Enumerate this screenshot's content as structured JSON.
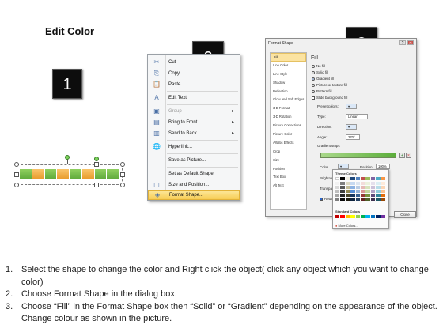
{
  "title": "Edit Color",
  "badges": [
    "1",
    "2",
    "3"
  ],
  "context_menu": {
    "items": [
      {
        "label": "Cut",
        "icon": "scissors-icon",
        "glyph": "✂"
      },
      {
        "label": "Copy",
        "icon": "copy-icon",
        "glyph": "⎘"
      },
      {
        "label": "Paste",
        "icon": "paste-icon",
        "glyph": "📋"
      },
      {
        "label": "Edit Text",
        "icon": "edit-text-icon",
        "glyph": "A"
      },
      {
        "label": "Group",
        "icon": "group-icon",
        "glyph": "▣"
      },
      {
        "label": "Bring to Front",
        "icon": "bring-front-icon",
        "glyph": "▤"
      },
      {
        "label": "Send to Back",
        "icon": "send-back-icon",
        "glyph": "▥"
      },
      {
        "label": "Hyperlink...",
        "icon": "hyperlink-icon",
        "glyph": "🌐"
      },
      {
        "label": "Save as Picture...",
        "icon": "",
        "glyph": ""
      },
      {
        "label": "Set as Default Shape",
        "icon": "",
        "glyph": ""
      },
      {
        "label": "Size and Position...",
        "icon": "size-position-icon",
        "glyph": "▢"
      },
      {
        "label": "Format Shape...",
        "icon": "format-shape-icon",
        "glyph": "◈"
      }
    ]
  },
  "dialog": {
    "title": "Format Shape",
    "nav": [
      "Fill",
      "Line Color",
      "Line Style",
      "Shadow",
      "Reflection",
      "Glow and Soft Edges",
      "3-D Format",
      "3-D Rotation",
      "Picture Corrections",
      "Picture Color",
      "Artistic Effects",
      "Crop",
      "Size",
      "Position",
      "Text Box",
      "Alt Text"
    ],
    "pane_title": "Fill",
    "fill_options": [
      "No fill",
      "Solid fill",
      "Gradient fill",
      "Picture or texture fill",
      "Pattern fill",
      "Slide background fill"
    ],
    "preset_colors_label": "Preset colors:",
    "type_label": "Type:",
    "type_value": "Linear",
    "direction_label": "Direction:",
    "angle_label": "Angle:",
    "angle_value": "270°",
    "gradient_stops_label": "Gradient stops",
    "color_label": "Color",
    "position_label": "Position:",
    "position_value": "100%",
    "brightness_label": "Brightness",
    "transparency_label": "Transparen",
    "rotate_label": "Rotate",
    "theme_colors_label": "Theme Colors",
    "standard_colors_label": "Standard Colors",
    "more_colors_label": "More Colors...",
    "close_label": "Close",
    "gradient_stop_colors": [
      "#a9d88a",
      "#5cae3b"
    ]
  },
  "steps": [
    {
      "num": "1.",
      "text": "Select the shape to change the color and Right click the object( click any object which you want to change color)"
    },
    {
      "num": "2.",
      "text": "Choose Format Shape in the dialog box."
    },
    {
      "num": "3.",
      "text": "Choose “Fill” in the Format Shape box then “Solid” or “Gradient” depending on the appearance of the object. Change colour as shown in the picture."
    }
  ]
}
